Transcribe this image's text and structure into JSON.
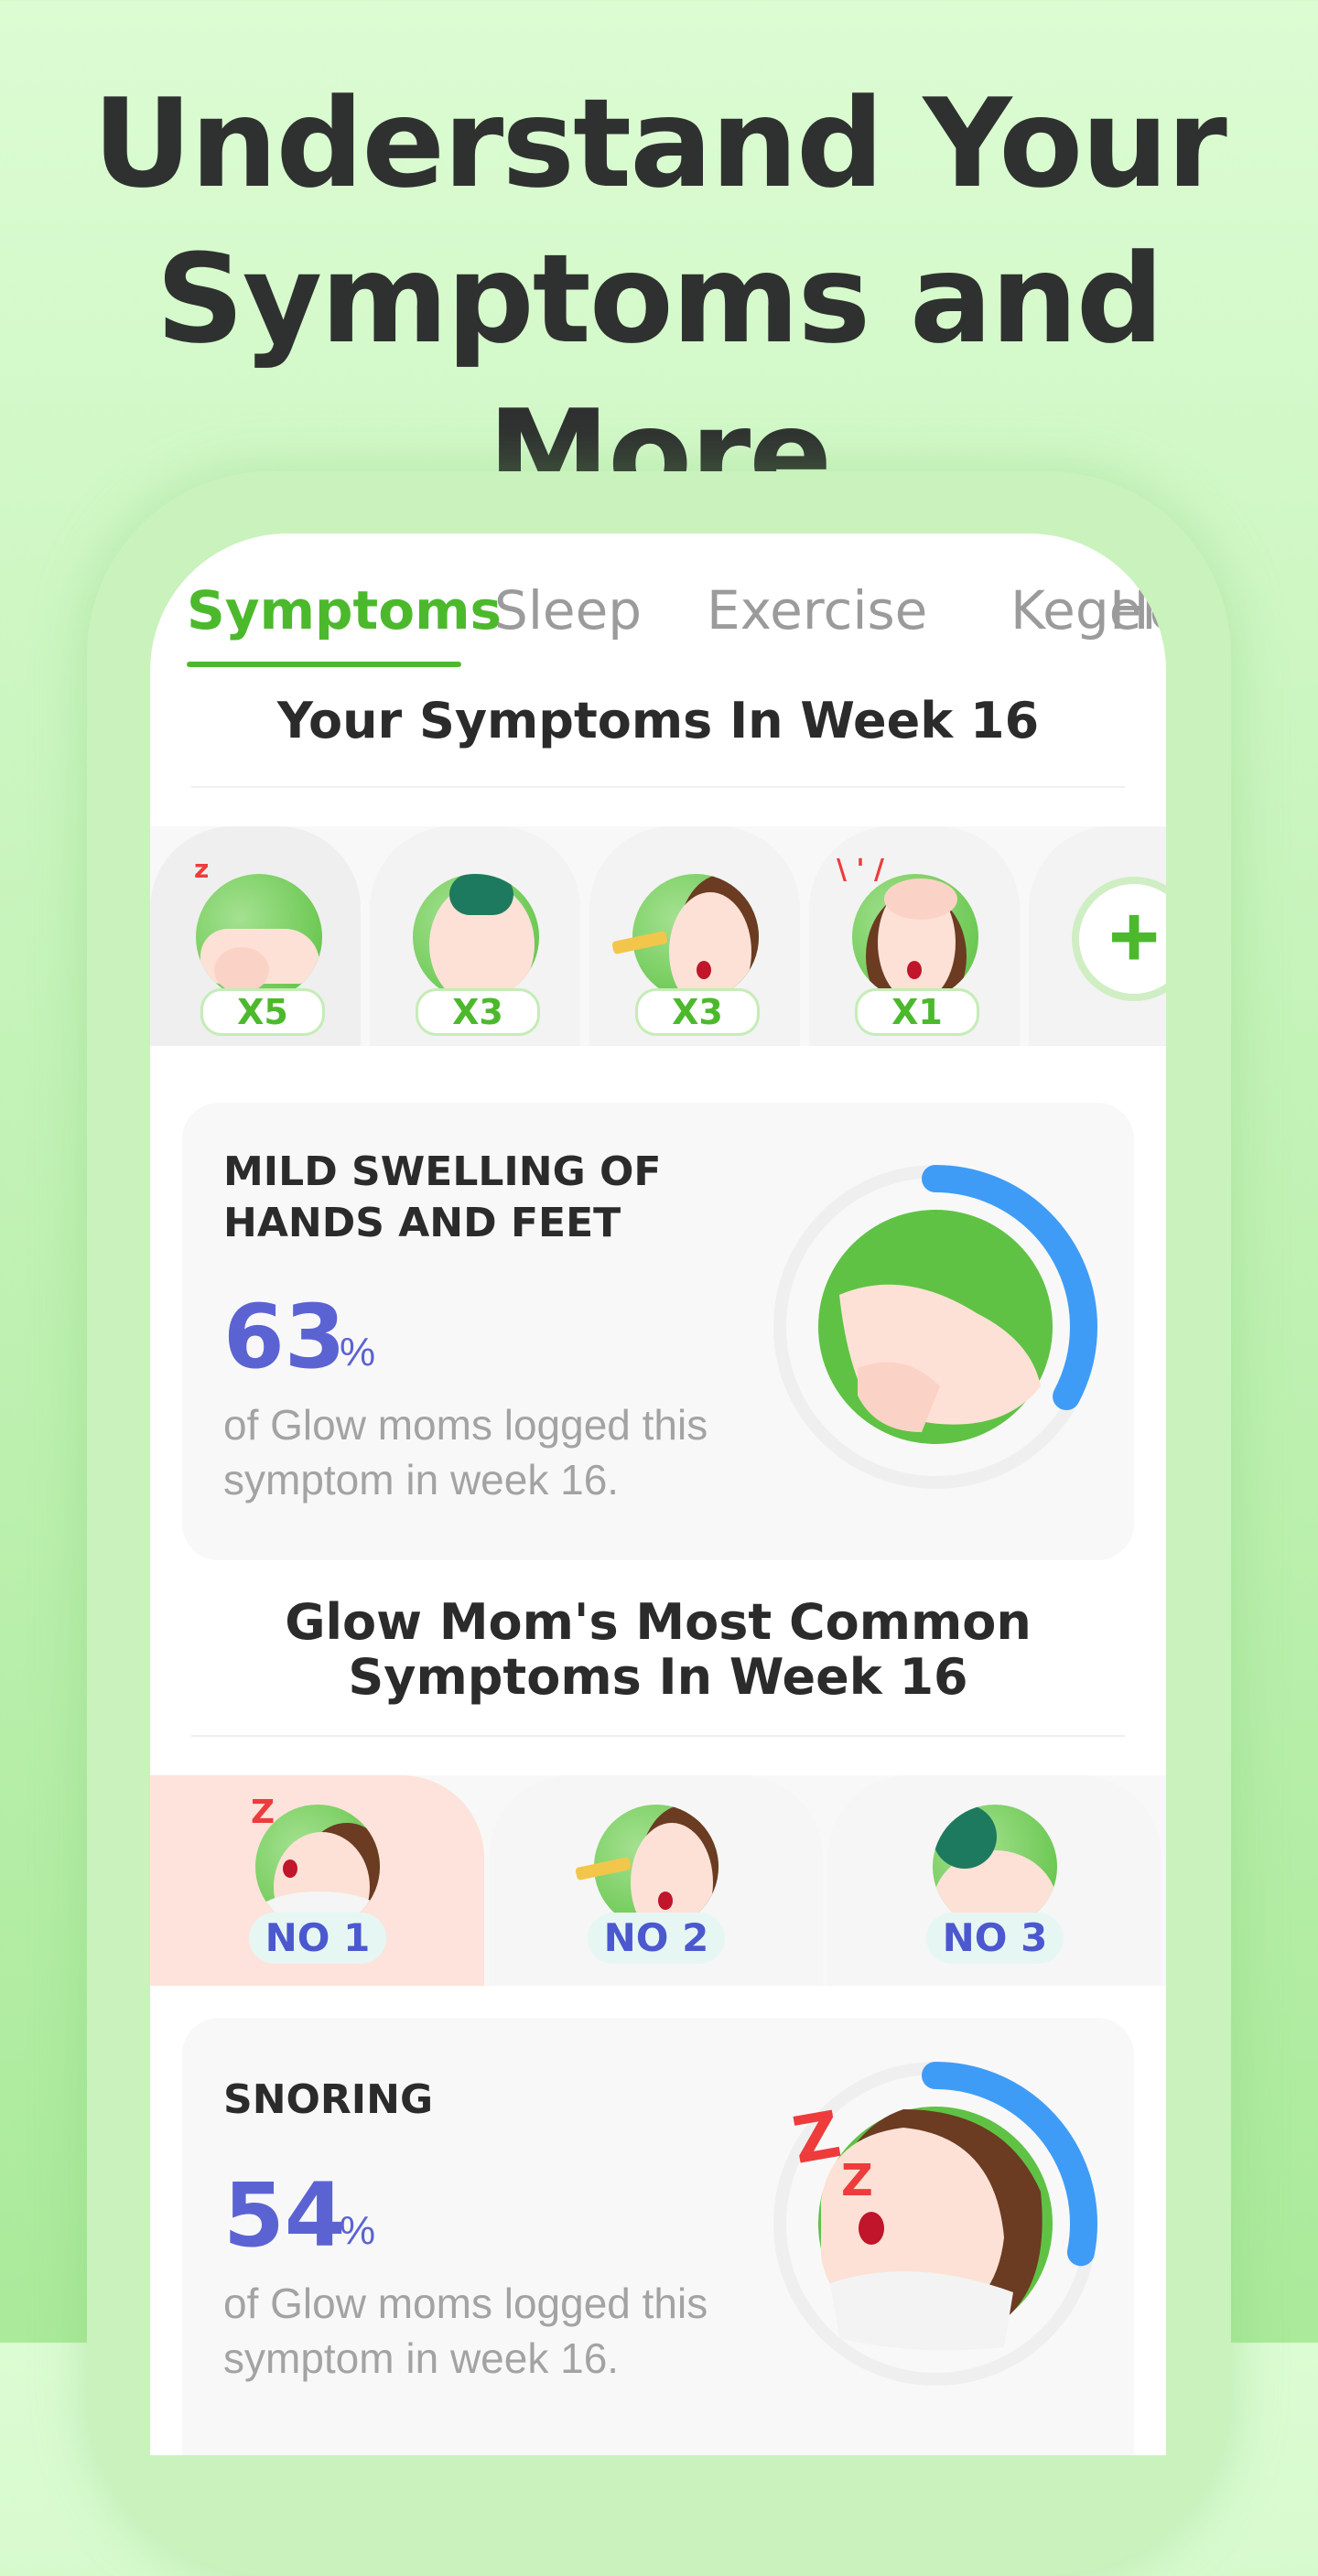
{
  "headline": {
    "line1": "Understand Your",
    "line2": "Symptoms and More"
  },
  "tabs": [
    {
      "label": "Symptoms",
      "active": true
    },
    {
      "label": "Sleep",
      "active": false
    },
    {
      "label": "Exercise",
      "active": false
    },
    {
      "label": "Kegels",
      "active": false
    },
    {
      "label": "He",
      "active": false
    }
  ],
  "your_symptoms": {
    "title": "Your Symptoms In Week 16",
    "items": [
      {
        "icon": "swollen-feet-icon",
        "count": "X5",
        "selected": true
      },
      {
        "icon": "belly-icon",
        "count": "X3",
        "selected": false
      },
      {
        "icon": "eating-sandwich-icon",
        "count": "X3",
        "selected": false
      },
      {
        "icon": "headache-icon",
        "count": "X1",
        "selected": false
      }
    ],
    "add_icon": "plus-icon"
  },
  "detail_card_1": {
    "title": "MILD SWELLING OF\nHANDS AND FEET",
    "percent": "63",
    "unit": "%",
    "percent_value": 63,
    "description": "of Glow moms logged this symptom in week 16."
  },
  "common_symptoms": {
    "title_line1": "Glow Mom's Most Common",
    "title_line2": "Symptoms In Week 16",
    "ranks": [
      {
        "label": "NO 1",
        "icon": "snoring-icon",
        "selected": true
      },
      {
        "label": "NO 2",
        "icon": "eating-sandwich-icon",
        "selected": false
      },
      {
        "label": "NO 3",
        "icon": "belly-icon",
        "selected": false
      }
    ]
  },
  "detail_card_2": {
    "title": "SNORING",
    "percent": "54",
    "unit": "%",
    "percent_value": 54,
    "description": "of Glow moms logged this symptom in week 16."
  },
  "colors": {
    "accent_green": "#4cb92d",
    "percent_blue": "#5b63d3",
    "ring_blue": "#3f9cf6",
    "alert_red": "#ee3b3b"
  }
}
